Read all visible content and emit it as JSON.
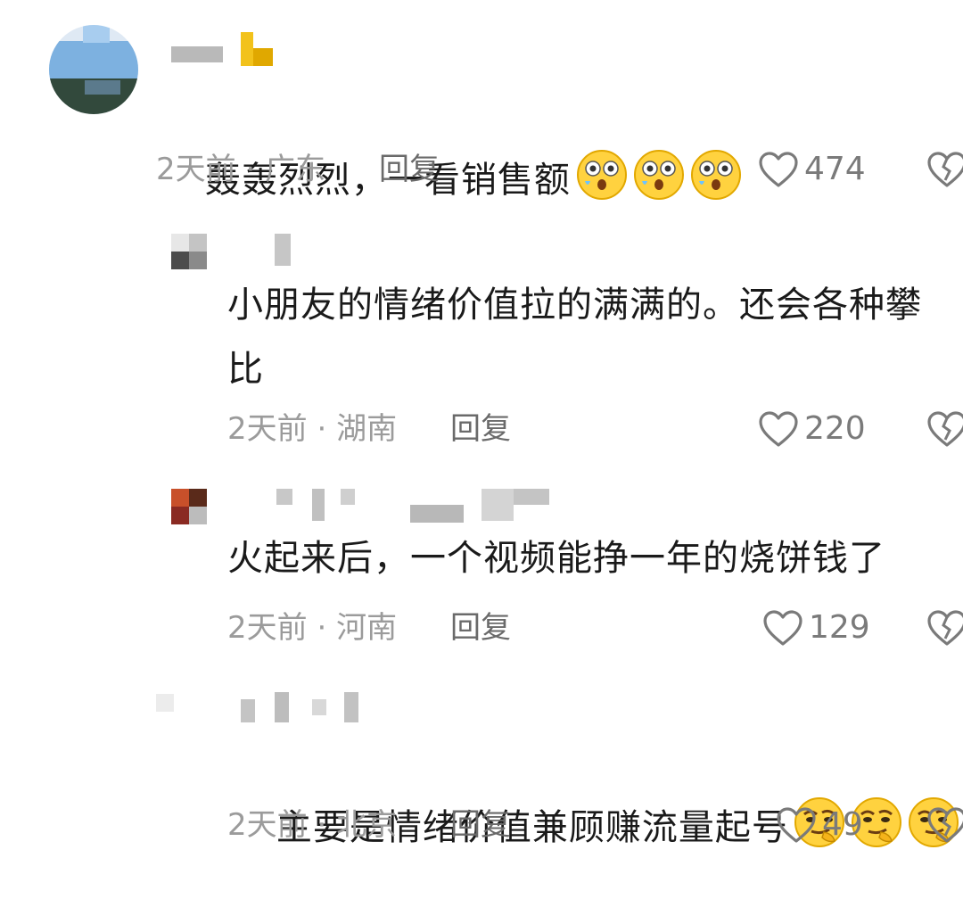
{
  "comments": [
    {
      "text": "轰轰烈烈，一看销售额",
      "emoji": "astonished-face-icon",
      "emoji_count": 3,
      "time": "2天前",
      "location": "广东",
      "reply_label": "回复",
      "likes": "474"
    },
    {
      "text": "小朋友的情绪价值拉的满满的。还会各种攀比",
      "time": "2天前",
      "location": "湖南",
      "reply_label": "回复",
      "likes": "220"
    },
    {
      "text": "火起来后，一个视频能挣一年的烧饼钱了",
      "time": "2天前",
      "location": "河南",
      "reply_label": "回复",
      "likes": "129"
    },
    {
      "text": "主要是情绪价值兼顾赚流量起号",
      "emoji": "smirking-thinking-face-icon",
      "emoji_count": 3,
      "time": "2天前",
      "location": "北京",
      "reply_label": "回复",
      "likes": "49"
    }
  ],
  "icons": {
    "like": "heart-outline-icon",
    "dislike": "broken-heart-icon"
  },
  "colors": {
    "text": "#1a1a1a",
    "meta": "#9b9b9b",
    "reply": "#6a6a6a",
    "background": "#ffffff"
  }
}
